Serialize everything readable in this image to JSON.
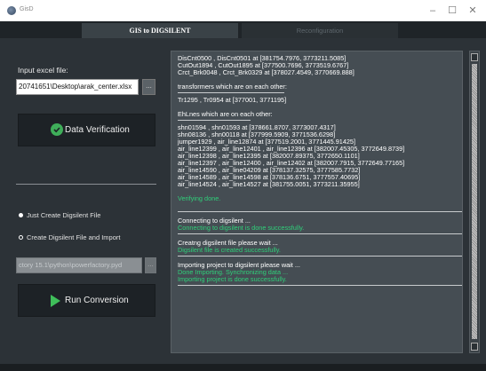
{
  "window": {
    "title": "GisD",
    "minimize": "–",
    "maximize": "☐",
    "close": "✕"
  },
  "tabs": [
    {
      "label": "GIS to DIGSILENT",
      "active": true
    },
    {
      "label": "Reconfiguration",
      "active": false
    }
  ],
  "left_panel": {
    "input_label": "Input excel file:",
    "input_value": "20741651\\Desktop\\arak_center.xlsx",
    "browse_label": "...",
    "verify_button": "Data Verification",
    "options": [
      {
        "label": "Just Create Digsilent File",
        "selected": true
      },
      {
        "label": "Create Digsilent File and Import",
        "selected": false
      }
    ],
    "pf_path_value": "ctory 15.1\\python\\powerfactory.pyd",
    "pf_browse_label": "...",
    "run_button": "Run Conversion"
  },
  "log": {
    "lines_1": [
      "DisCnt0500 , DisCnt0501 at [381754.7976, 3773211.5085]",
      "CutOut1894 , CutOut1895 at [377500.7696, 3773519.6767]",
      "Crct_Brk0048 , Crct_Brk0329 at [378027.4549, 3770669.888]"
    ],
    "transformers_header": "transformers which are on each other:",
    "transformers_lines": [
      "Tr1295 , Tr0954 at [377001, 3771195]"
    ],
    "lines_header": "EhLnes which are on each other:",
    "lines_list": [
      "shn01594 , shn01593 at [378661.8707, 3773007.4317]",
      "shn08136 , shn00118 at [377999.5909, 3771536.6298]",
      "jumper1929 , air_line12874 at [377519.2001, 3771445.91425]",
      "air_line12399 , air_line12401 , air_line12396 at [382007.45305, 3772649.8739]",
      "air_line12398 , air_line12395 at [382007.89375, 3772650.1101]",
      "air_line12397 , air_line12400 , air_line12402 at [382007.7915, 3772649.77165]",
      "air_line14590 , air_line04209 at [378137.32575, 3777585.7732]",
      "air_line14589 , air_line14598 at [378136.6751, 3777557.40695]",
      "air_line14524 , air_line14527 at [381755.0051, 3773211.35955]"
    ],
    "verifying_done": "Verifying done.",
    "connecting": "Connecting to digsilent ...",
    "connecting_done": "Connecting to digsilent is done successfully.",
    "creating": "Creatng digsilent file please wait ...",
    "creating_done": "Digsilent file is created successfully.",
    "importing": "Importing project to digsilent please wait ...",
    "importing_sync": "Done Importing. Synchronizing data ...",
    "importing_done": "Importing project is done successfully."
  },
  "colors": {
    "background": "#2c3237",
    "log_background": "#454d53",
    "success_green": "#2fd07a",
    "button_dark": "#1d2226"
  }
}
